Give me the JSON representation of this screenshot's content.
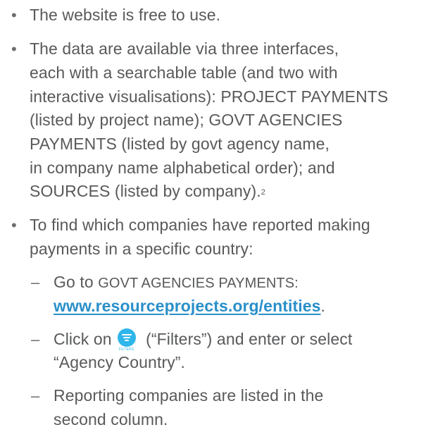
{
  "bullets": [
    {
      "lines": [
        "The website is free to use."
      ]
    },
    {
      "lines": [
        "The data are available via three interfaces,",
        "each with a searchable table (and two with",
        "interactive visualisations): PROJECT PAYMENTS",
        "(listed by project name); GOVT AGENCIES",
        "PAYMENTS (listed by govt agency name,",
        "in company name alphabetical order); and",
        "SOURCES (listed by company)."
      ],
      "footnote": "2"
    },
    {
      "lines": [
        "To find which companies have reported making",
        "payments in a specific country:"
      ]
    }
  ],
  "subitems": {
    "go_to_text": "Go to ",
    "go_to_caps": "GOVT AGENCIES PAYMENTS:",
    "link": "www.resourceprojects.org/entities",
    "link_period": ".",
    "click_on": "Click on",
    "filters_quote": " (“Filters”) and enter or select",
    "agency_country": "“Agency Country”.",
    "reporting_line1": "Reporting companies are listed in the",
    "reporting_line2": "second column."
  },
  "icons": {
    "filter_icon": {
      "name": "filter-icon",
      "caption": "FILTERS",
      "color": "#2fb6ea"
    }
  },
  "colors": {
    "text": "#58595b",
    "link": "#2a8fc9"
  },
  "markers": {
    "bullet": "•",
    "dash": "–"
  }
}
